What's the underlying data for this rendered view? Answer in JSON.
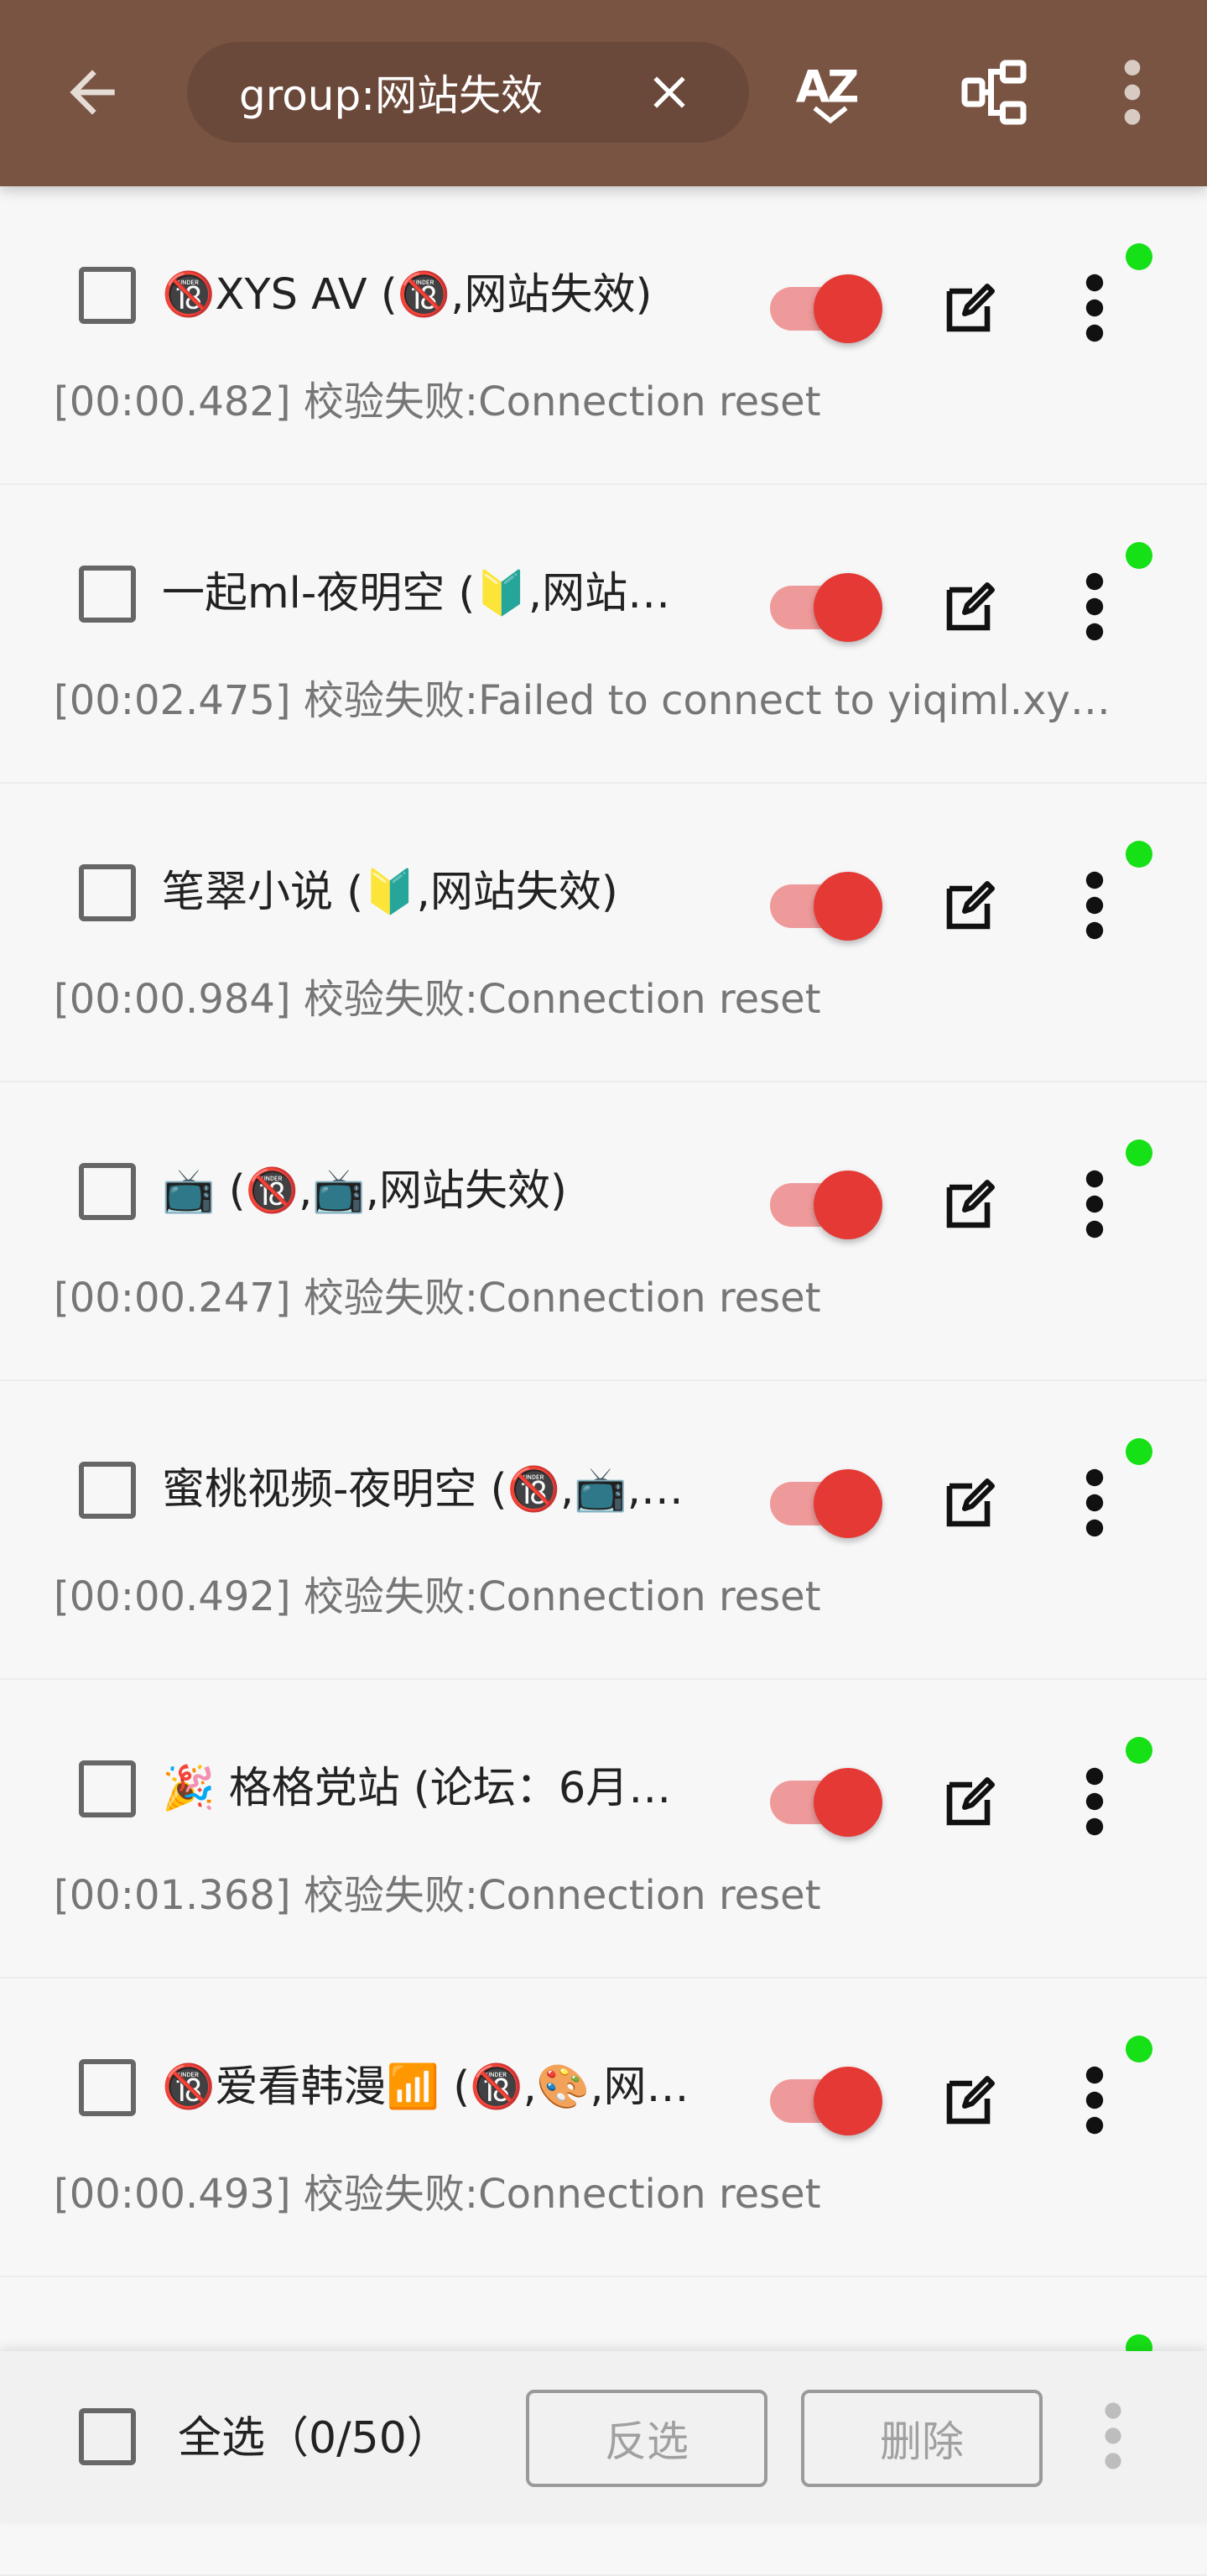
{
  "appbar": {
    "search_text": "group:网站失效",
    "colors": {
      "background": "#7a5443",
      "icon": "#ffffff"
    },
    "icons": [
      "arrow-back-icon",
      "close-icon",
      "sort-az-icon",
      "tree-structure-icon",
      "more-vertical-icon"
    ]
  },
  "sources": [
    {
      "title": "🔞XYS AV (🔞,网站失效)",
      "status": "[00:00.482] 校验失败:Connection reset",
      "enabled": true
    },
    {
      "title": "一起ml-夜明空 (🔰,网站…",
      "status": "[00:02.475] 校验失败:Failed to connect to yiqiml.xy…",
      "enabled": true
    },
    {
      "title": "笔翠小说 (🔰,网站失效)",
      "status": "[00:00.984] 校验失败:Connection reset",
      "enabled": true
    },
    {
      "title": "📺 (🔞,📺,网站失效)",
      "status": "[00:00.247] 校验失败:Connection reset",
      "enabled": true
    },
    {
      "title": "蜜桃视频-夜明空 (🔞,📺,…",
      "status": "[00:00.492] 校验失败:Connection reset",
      "enabled": true
    },
    {
      "title": "🎉 格格党站 (论坛：6月…",
      "status": "[00:01.368] 校验失败:Connection reset",
      "enabled": true
    },
    {
      "title": "🔞爱看韩漫📶 (🔞,🎨,网…",
      "status": "[00:00.493] 校验失败:Connection reset",
      "enabled": true
    },
    {
      "title": "",
      "status": "",
      "enabled": true
    }
  ],
  "row_colors": {
    "switch_on": "#e53935",
    "switch_track": "#ef9a9a",
    "status_dot": "#16e016"
  },
  "bottombar": {
    "select_all_label": "全选（0/50）",
    "invert_label": "反选",
    "delete_label": "删除"
  }
}
